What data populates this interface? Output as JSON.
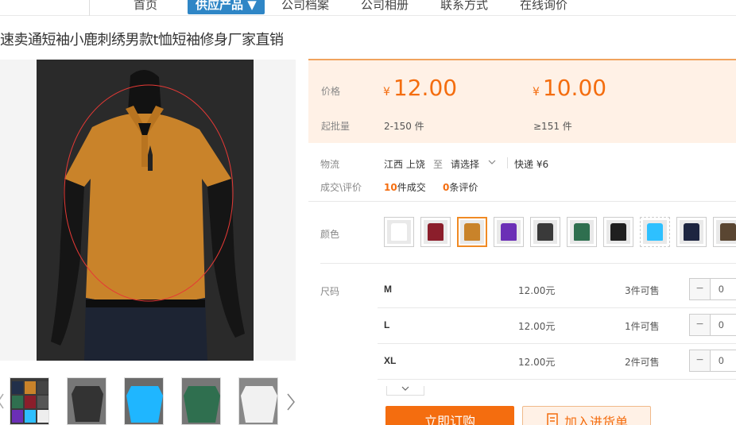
{
  "nav": {
    "items": [
      "首页",
      "供应产品 ▼",
      "公司档案",
      "公司相册",
      "联系方式",
      "在线询价"
    ],
    "active_index": 1
  },
  "product": {
    "title": "速卖通短袖小鹿刺绣男款t恤短袖修身厂家直销"
  },
  "price": {
    "label": "价格",
    "currency": "¥",
    "tier1": "12.00",
    "tier2": "10.00",
    "moq_label": "起批量",
    "moq1": "2-150 件",
    "moq2": "≥151 件"
  },
  "logistics": {
    "label": "物流",
    "from": "江西 上饶",
    "to_word": "至",
    "select_placeholder": "请选择",
    "express": "快递 ¥6",
    "deals_label": "成交\\评价",
    "deals_count": "10",
    "deals_suffix": "件成交",
    "reviews_count": "0",
    "reviews_suffix": "条评价"
  },
  "color": {
    "label": "颜色",
    "selected_index": 2,
    "swatches": [
      "#ffffff",
      "#8b1e2b",
      "#c9832a",
      "#6b2fb6",
      "#3a3a3a",
      "#2f6f4f",
      "#1f1f1f",
      "#2ec0ff",
      "#1d2540",
      "#5a4632"
    ]
  },
  "size": {
    "label": "尺码",
    "rows": [
      {
        "name": "M",
        "price": "12.00元",
        "stock": "3件可售",
        "qty": "0"
      },
      {
        "name": "L",
        "price": "12.00元",
        "stock": "1件可售",
        "qty": "0"
      },
      {
        "name": "XL",
        "price": "12.00元",
        "stock": "2件可售",
        "qty": "0"
      }
    ]
  },
  "actions": {
    "buy": "立即订购",
    "cart": "加入进货单"
  },
  "thumb_colors": [
    "#444444",
    "#333333",
    "#1fb6ff",
    "#2f6f4f",
    "#eeeeee"
  ]
}
